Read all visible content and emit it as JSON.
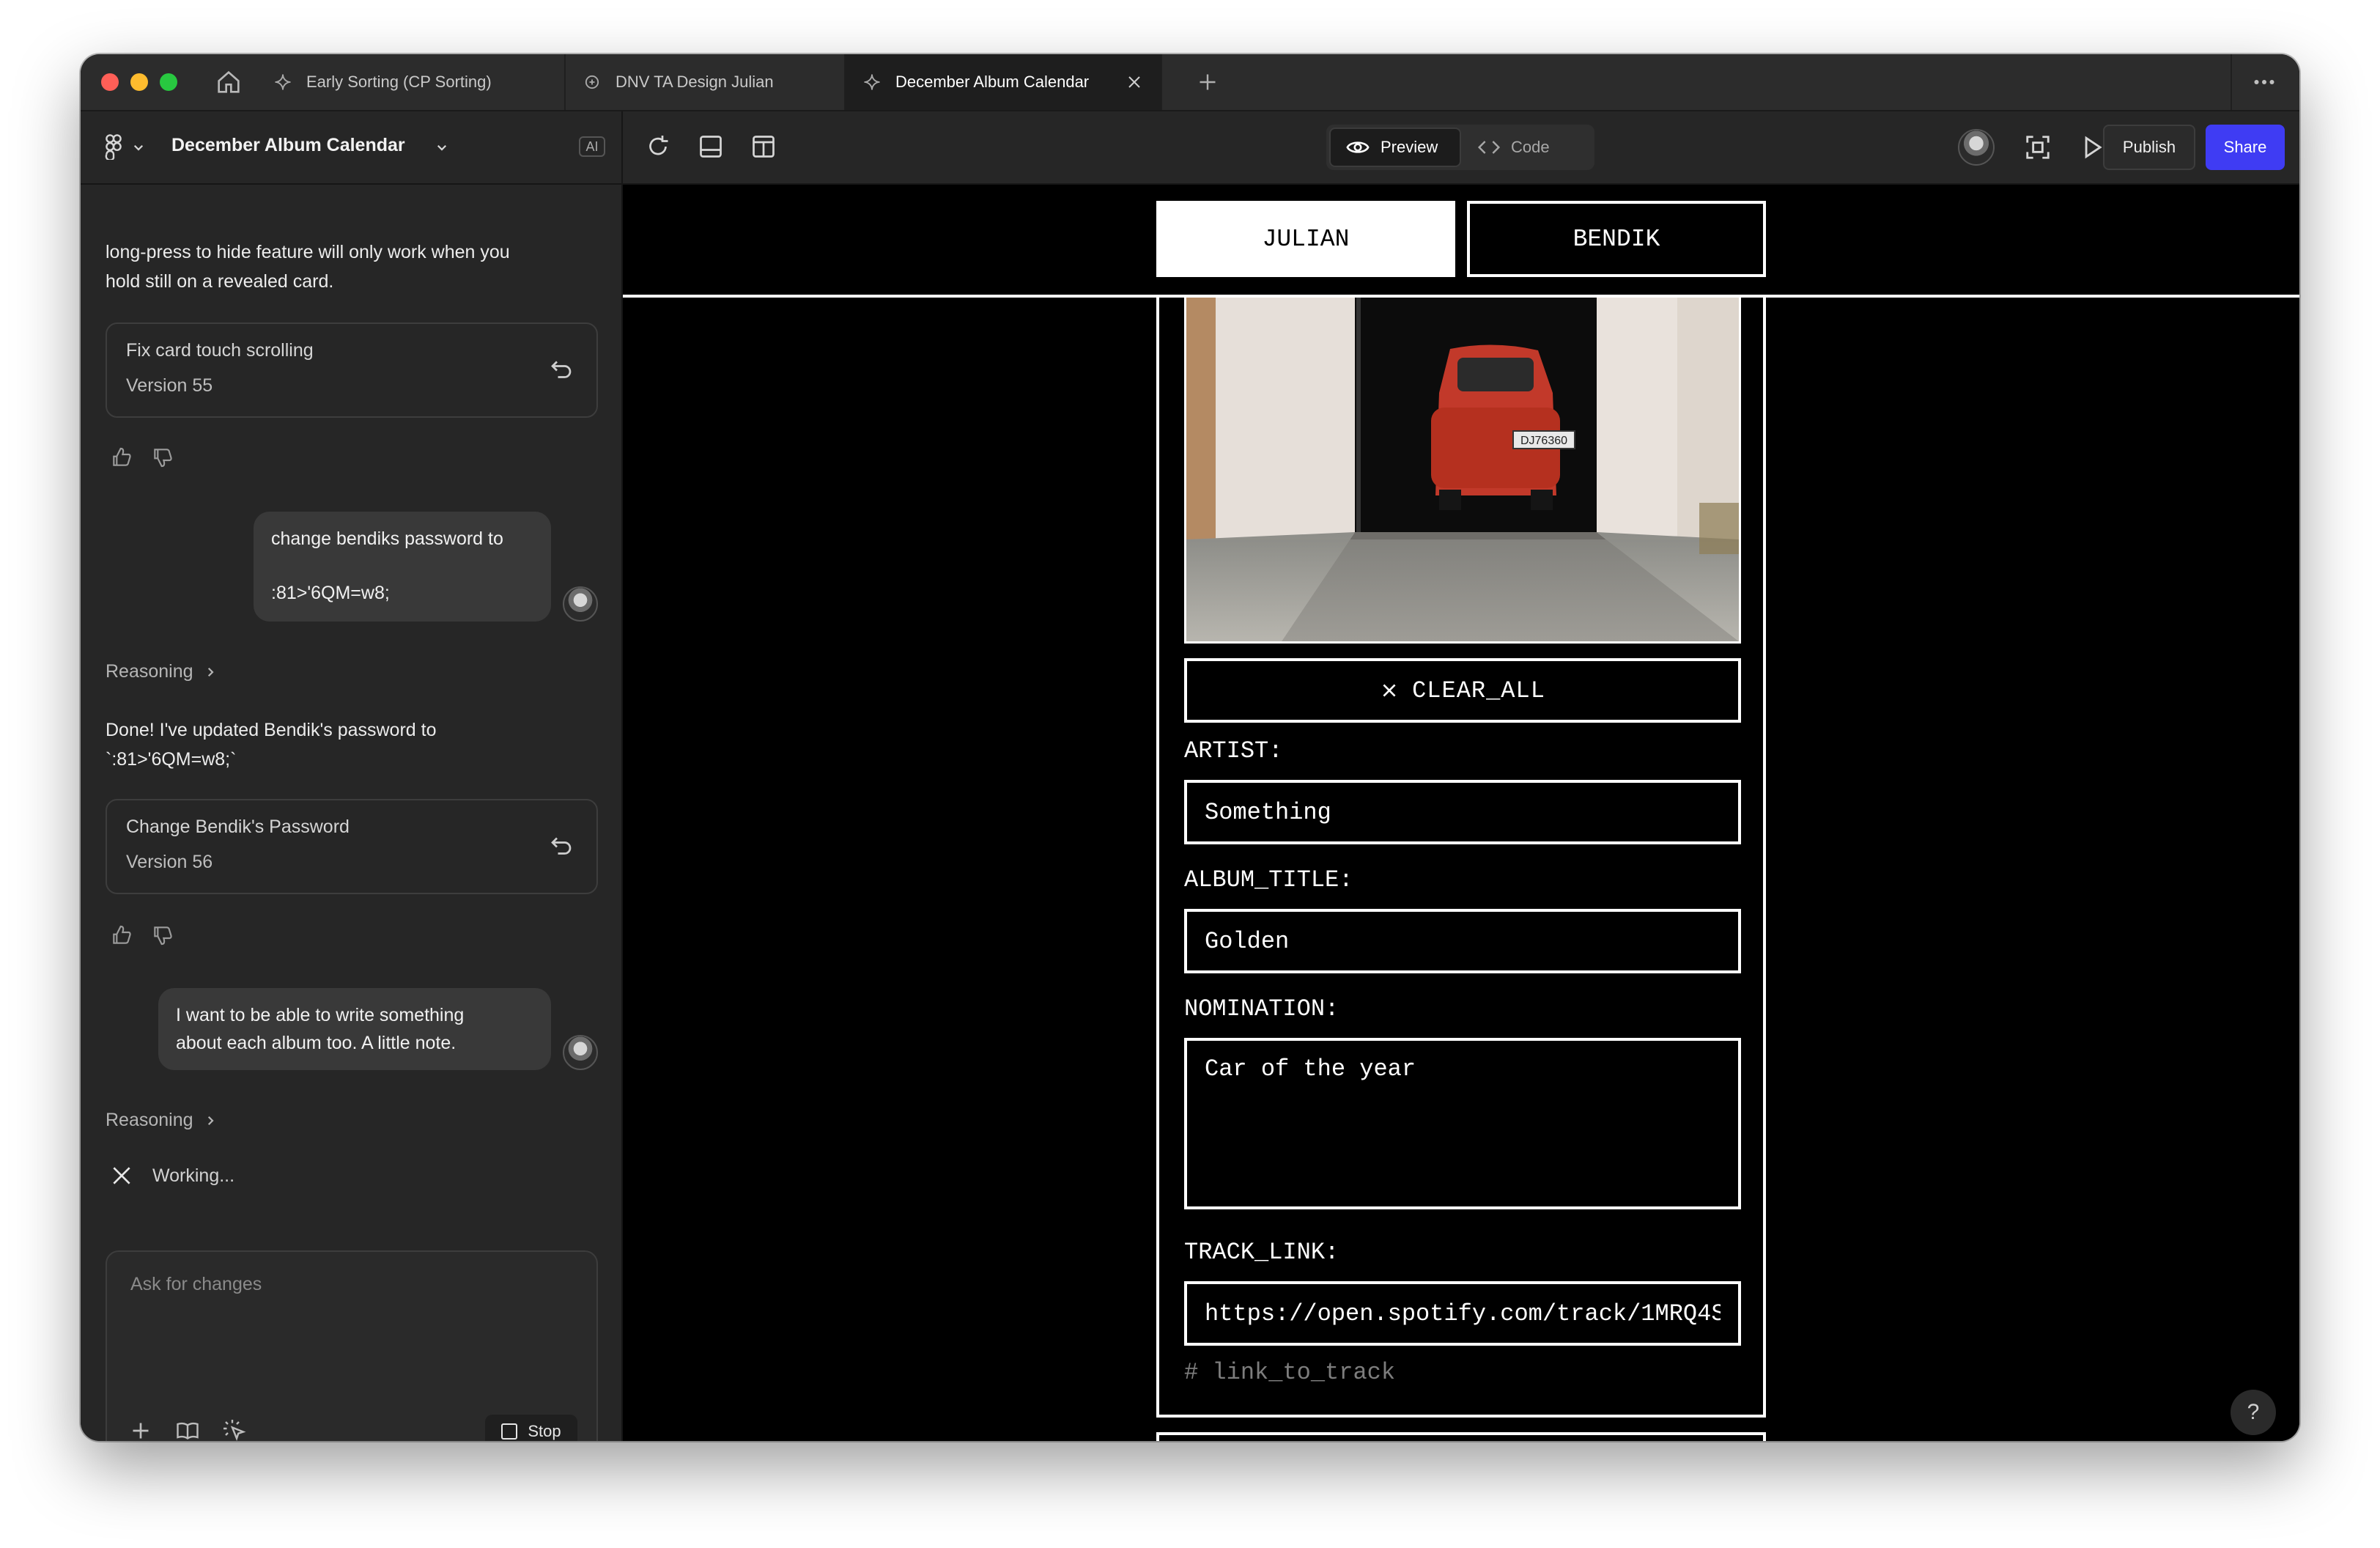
{
  "tabs": [
    {
      "label": "Early Sorting (CP Sorting)",
      "icon": "sparkle-icon"
    },
    {
      "label": "DNV TA Design Julian",
      "icon": "gear-spark-icon"
    },
    {
      "label": "December Album Calendar",
      "icon": "sparkle-icon",
      "active": true
    }
  ],
  "toolbar": {
    "project_title": "December Album Calendar",
    "ai_badge": "AI",
    "preview_label": "Preview",
    "code_label": "Code",
    "publish_label": "Publish",
    "share_label": "Share"
  },
  "chat": {
    "top_text_line1": "long-press to hide feature will only work when you",
    "top_text_line2": "hold still on a revealed card.",
    "version_55_title": "Fix card touch scrolling",
    "version_55_sub": "Version 55",
    "user_msg1_line1": "change bendiks password to",
    "user_msg1_line2": ":81>'6QM=w8;",
    "reasoning_label": "Reasoning",
    "assistant_line1": "Done! I've updated Bendik's password to",
    "assistant_line2": "`:81>'6QM=w8;`",
    "version_56_title": "Change Bendik's Password",
    "version_56_sub": "Version 56",
    "user_msg2_line1": "I want to be able to write something",
    "user_msg2_line2": "about each album too. A little note.",
    "working_label": "Working...",
    "composer_placeholder": "Ask for changes",
    "stop_label": "Stop"
  },
  "app": {
    "users": [
      "JULIAN",
      "BENDIK"
    ],
    "active_user": "JULIAN",
    "clear_label": "CLEAR_ALL",
    "artist_label": "ARTIST:",
    "artist_value": "Something",
    "album_title_label": "ALBUM_TITLE:",
    "album_title_value": "Golden",
    "nomination_label": "NOMINATION:",
    "nomination_value": "Car of the year",
    "track_link_label": "TRACK_LINK:",
    "track_link_value": "https://open.spotify.com/track/1MRQ4S",
    "track_hint": "# link_to_track",
    "license_plate": "DJ76360"
  },
  "colors": {
    "share_button": "#3f3cf3",
    "preview_bg": "#000000",
    "sidebar_bg": "#262626"
  }
}
